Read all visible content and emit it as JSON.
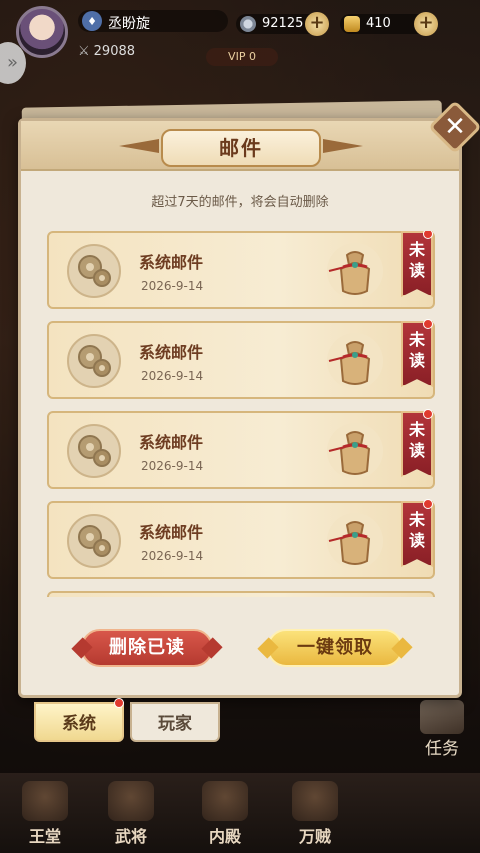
{
  "top_bar": {
    "player_name": "丞盼旋",
    "power": "29088",
    "vip": "VIP 0",
    "coins": "92125",
    "ingots": "410"
  },
  "mail_panel": {
    "title": "邮件",
    "notice": "超过7天的邮件，将会自动删除",
    "mails": [
      {
        "title": "系统邮件",
        "date": "2026-9-14",
        "status": "未读"
      },
      {
        "title": "系统邮件",
        "date": "2026-9-14",
        "status": "未读"
      },
      {
        "title": "系统邮件",
        "date": "2026-9-14",
        "status": "未读"
      },
      {
        "title": "系统邮件",
        "date": "2026-9-14",
        "status": "未读"
      }
    ],
    "delete_read_label": "删除已读",
    "claim_all_label": "一键领取",
    "close_label": "✕"
  },
  "tabs": {
    "system": "系统",
    "player": "玩家"
  },
  "side": {
    "task": "任务"
  },
  "bottom_nav": [
    {
      "label": "王堂"
    },
    {
      "label": "武将"
    },
    {
      "label": "内殿"
    },
    {
      "label": "万贼"
    }
  ],
  "colors": {
    "panel_bg": "#efe8db",
    "unread_tag": "#b2343a",
    "claim_button": "#eab840",
    "delete_button": "#c8473c"
  }
}
